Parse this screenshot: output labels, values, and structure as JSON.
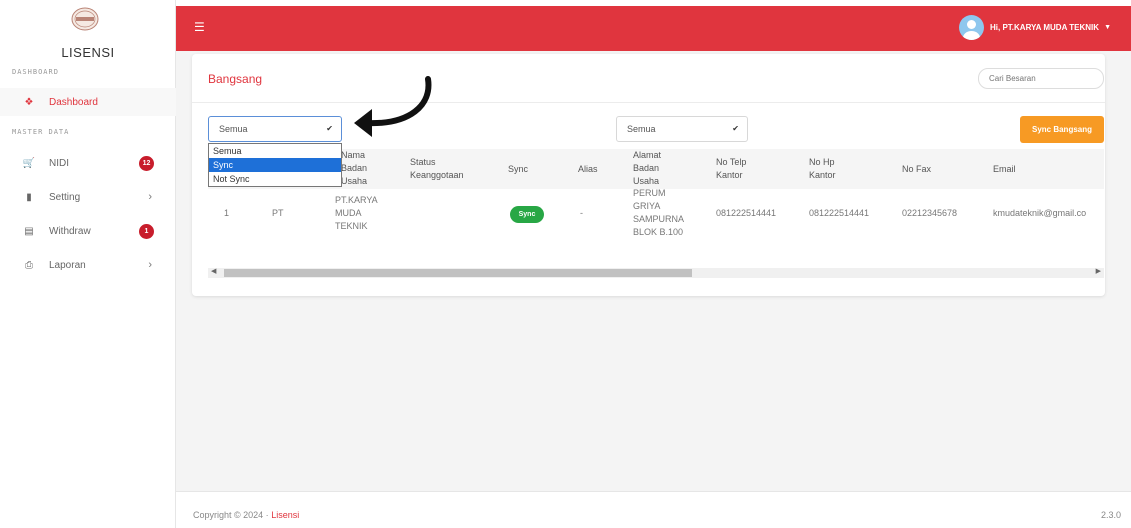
{
  "sidebar": {
    "brand": "LISENSI",
    "sections": [
      "DASHBOARD",
      "MASTER DATA"
    ],
    "items": [
      {
        "label": "Dashboard",
        "icon": "home-icon"
      },
      {
        "label": "NIDI",
        "icon": "cart-icon",
        "badge": "12"
      },
      {
        "label": "Setting",
        "icon": "file-icon"
      },
      {
        "label": "Withdraw",
        "icon": "wallet-icon",
        "badge": "1"
      },
      {
        "label": "Laporan",
        "icon": "printer-icon"
      }
    ]
  },
  "topbar": {
    "user_label": "Hi, PT.KARYA MUDA TEKNIK"
  },
  "card": {
    "title": "Bangsang",
    "search_placeholder": "Cari Besaran",
    "filter_left_value": "Semua",
    "filter_right_value": "Semua",
    "sync_button": "Sync Bangsang",
    "dropdown_options": [
      "Semua",
      "Sync",
      "Not Sync"
    ],
    "dropdown_selected": "Sync"
  },
  "table": {
    "headers": {
      "nama": [
        "Nama",
        "Badan",
        "Usaha"
      ],
      "status": [
        "Status",
        "Keanggotaan"
      ],
      "sync": "Sync",
      "alias": "Alias",
      "alamat": [
        "Alamat",
        "Badan",
        "Usaha"
      ],
      "telp": [
        "No Telp",
        "Kantor"
      ],
      "hp": [
        "No Hp",
        "Kantor"
      ],
      "fax": "No Fax",
      "email": "Email"
    },
    "row": {
      "no": "1",
      "type": "PT",
      "nama": [
        "PT.KARYA",
        "MUDA",
        "TEKNIK"
      ],
      "sync": "Sync",
      "alias": "-",
      "alamat": [
        "PERUM",
        "GRIYA",
        "SAMPURNA",
        "BLOK B.100"
      ],
      "telp": "081222514441",
      "hp": "081222514441",
      "fax": "02212345678",
      "email": "kmudateknik@gmail.co"
    }
  },
  "footer": {
    "copyright": "Copyright © 2024 ·",
    "brand": "Lisensi",
    "version": "2.3.0"
  },
  "colors": {
    "primary": "#e0353e",
    "accent_orange": "#f79a24",
    "success": "#28a745",
    "badge": "#c81d2c",
    "dropdown_highlight": "#1e70d8"
  }
}
